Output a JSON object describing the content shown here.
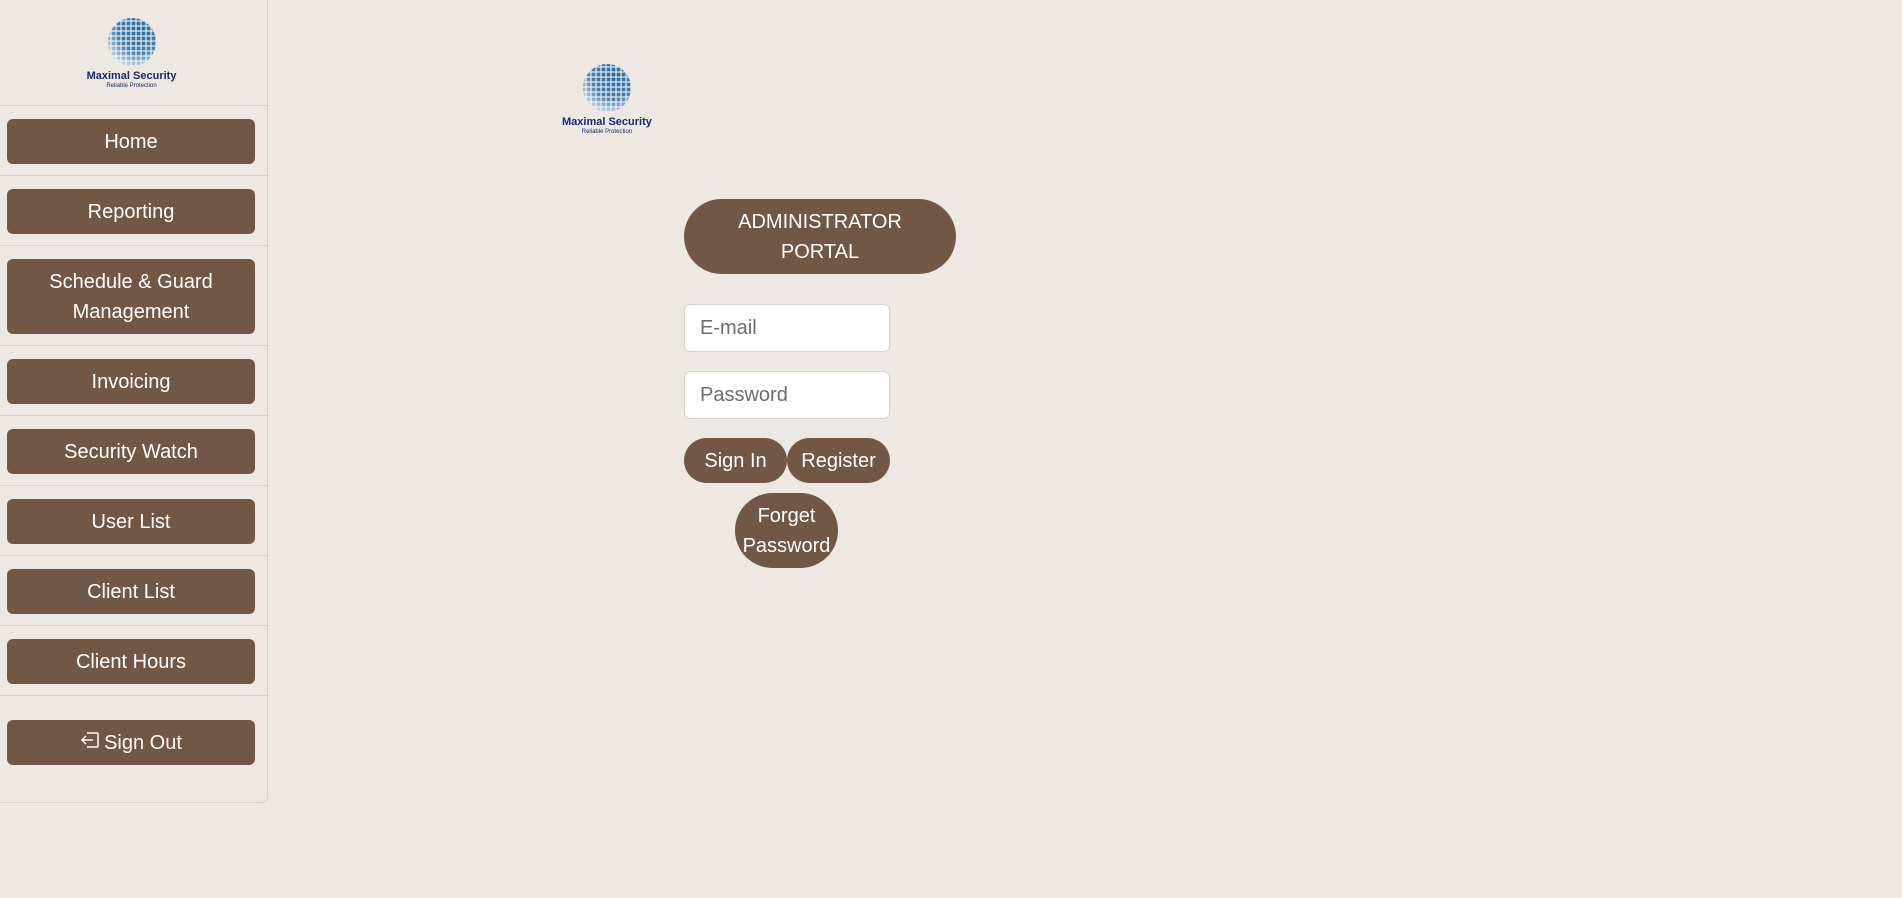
{
  "brand": {
    "name": "Maximal Security",
    "tagline": "Reliable Protection",
    "logo_icon": "globe-icon",
    "colors": {
      "globe_dark": "#1f6aa5",
      "globe_light": "#9ccbe6",
      "text": "#1a2a6b"
    }
  },
  "sidebar": {
    "items": [
      {
        "label": "Home"
      },
      {
        "label": "Reporting"
      },
      {
        "label": "Schedule & Guard Management"
      },
      {
        "label": "Invoicing"
      },
      {
        "label": "Security Watch"
      },
      {
        "label": "User List"
      },
      {
        "label": "Client List"
      },
      {
        "label": "Client Hours"
      }
    ],
    "signout": {
      "label": "Sign Out",
      "icon": "sign-out-icon"
    }
  },
  "login": {
    "title": "ADMINISTRATOR PORTAL",
    "email_placeholder": "E-mail",
    "password_placeholder": "Password",
    "signin_label": "Sign In",
    "register_label": "Register",
    "forget_label": "Forget Password"
  },
  "colors": {
    "background": "#ede8e2",
    "button": "#735746",
    "button_text": "#ffffff"
  }
}
